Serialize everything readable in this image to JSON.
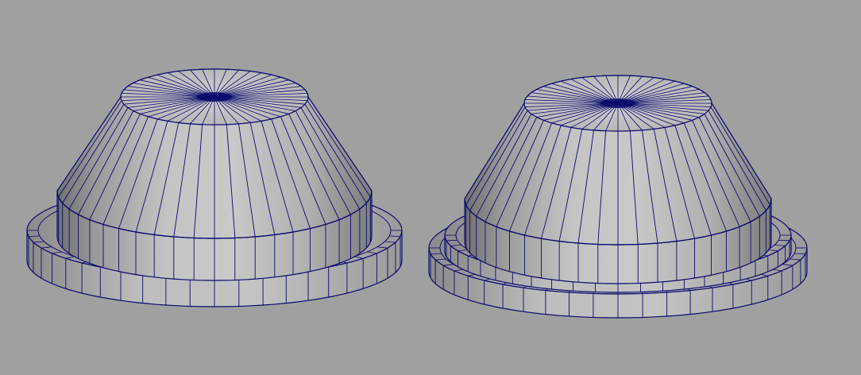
{
  "viewport": {
    "background": "#a0a0a0",
    "wire_color": "#0a0a6e",
    "shade_light": "#c8c8c8",
    "shade_mid": "#a9a9a9",
    "shade_dark": "#6e6e6e"
  },
  "objects": [
    {
      "name": "left-mesh",
      "base_rings": 1
    },
    {
      "name": "right-mesh",
      "base_rings": 2
    }
  ]
}
